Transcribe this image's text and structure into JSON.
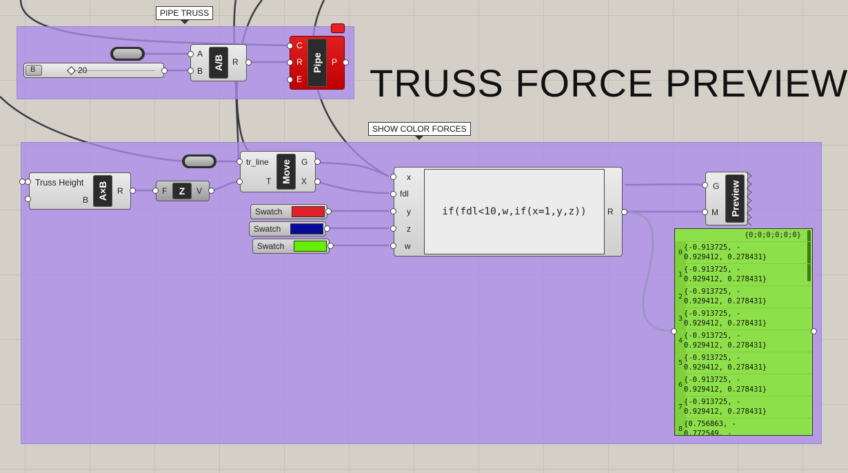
{
  "canvas_title": "TRUSS FORCE PREVIEW",
  "groups": {
    "pipe_truss_label": "PIPE TRUSS",
    "show_color_forces_label": "SHOW COLOR FORCES"
  },
  "slider": {
    "label": "B",
    "value": "20"
  },
  "division": {
    "nick": "A/B",
    "in_a": "A",
    "in_b": "B",
    "out": "R"
  },
  "pipe": {
    "nick": "Pipe",
    "in_c": "C",
    "in_r": "R",
    "in_e": "E",
    "out": "P"
  },
  "multiply": {
    "label": "Truss Height",
    "nick": "A×B",
    "in_b": "B",
    "out": "R"
  },
  "unit_z": {
    "nick": "Z",
    "in": "F",
    "out": "V"
  },
  "move": {
    "nick": "Move",
    "in_g": "tr_line",
    "in_t": "T",
    "out_g": "G",
    "out_x": "X"
  },
  "swatches": [
    {
      "label": "Swatch",
      "color": "#e0202a"
    },
    {
      "label": "Swatch",
      "color": "#0a0a9a"
    },
    {
      "label": "Swatch",
      "color": "#66ee00"
    }
  ],
  "expression": {
    "formula": "if(fdl<10,w,if(x=1,y,z))",
    "inputs": [
      "x",
      "fdl",
      "y",
      "z",
      "w"
    ],
    "output": "R"
  },
  "preview": {
    "nick": "Preview",
    "in_g": "G",
    "in_m": "M"
  },
  "panel": {
    "header": "{0;0;0;0;0;0}",
    "rows": [
      {
        "index": "0",
        "text": "{-0.913725, -\n0.929412, 0.278431}"
      },
      {
        "index": "1",
        "text": "{-0.913725, -\n0.929412, 0.278431}"
      },
      {
        "index": "2",
        "text": "{-0.913725, -\n0.929412, 0.278431}"
      },
      {
        "index": "3",
        "text": "{-0.913725, -\n0.929412, 0.278431}"
      },
      {
        "index": "4",
        "text": "{-0.913725, -\n0.929412, 0.278431}"
      },
      {
        "index": "5",
        "text": "{-0.913725, -\n0.929412, 0.278431}"
      },
      {
        "index": "6",
        "text": "{-0.913725, -\n0.929412, 0.278431}"
      },
      {
        "index": "7",
        "text": "{-0.913725, -\n0.929412, 0.278431}"
      },
      {
        "index": "8",
        "text": "{0.756863, -\n0.772549, -"
      }
    ]
  },
  "colors": {
    "group_fill": "#aa8ceb",
    "pipe_red": "#d81818",
    "panel_green": "#8ee04a",
    "wire": "#404048",
    "wire_selected": "#6cb83a"
  }
}
